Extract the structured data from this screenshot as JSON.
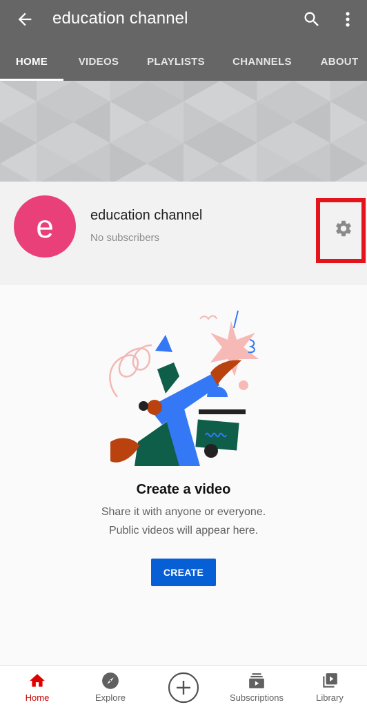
{
  "header": {
    "title": "education channel",
    "back_icon": "arrow-left-icon",
    "search_icon": "search-icon",
    "more_icon": "more-vertical-icon"
  },
  "tabs": [
    {
      "label": "HOME",
      "active": true
    },
    {
      "label": "VIDEOS",
      "active": false
    },
    {
      "label": "PLAYLISTS",
      "active": false
    },
    {
      "label": "CHANNELS",
      "active": false
    },
    {
      "label": "ABOUT",
      "active": false
    }
  ],
  "channel": {
    "avatar_letter": "e",
    "name": "education channel",
    "subscribers": "No subscribers",
    "settings_icon": "gear-icon",
    "avatar_color": "#e9407a",
    "highlight_color": "#e3141c"
  },
  "empty_state": {
    "title": "Create a video",
    "line1": "Share it with anyone or everyone.",
    "line2": "Public videos will appear here.",
    "button_label": "CREATE",
    "button_color": "#065fd4"
  },
  "bottom_nav": [
    {
      "label": "Home",
      "icon": "home-icon",
      "active": true
    },
    {
      "label": "Explore",
      "icon": "compass-icon",
      "active": false
    },
    {
      "label": "",
      "icon": "plus-circle-icon",
      "active": false
    },
    {
      "label": "Subscriptions",
      "icon": "subscriptions-icon",
      "active": false
    },
    {
      "label": "Library",
      "icon": "library-icon",
      "active": false
    }
  ],
  "colors": {
    "header_bg": "#666666",
    "active_nav": "#cc0000"
  }
}
